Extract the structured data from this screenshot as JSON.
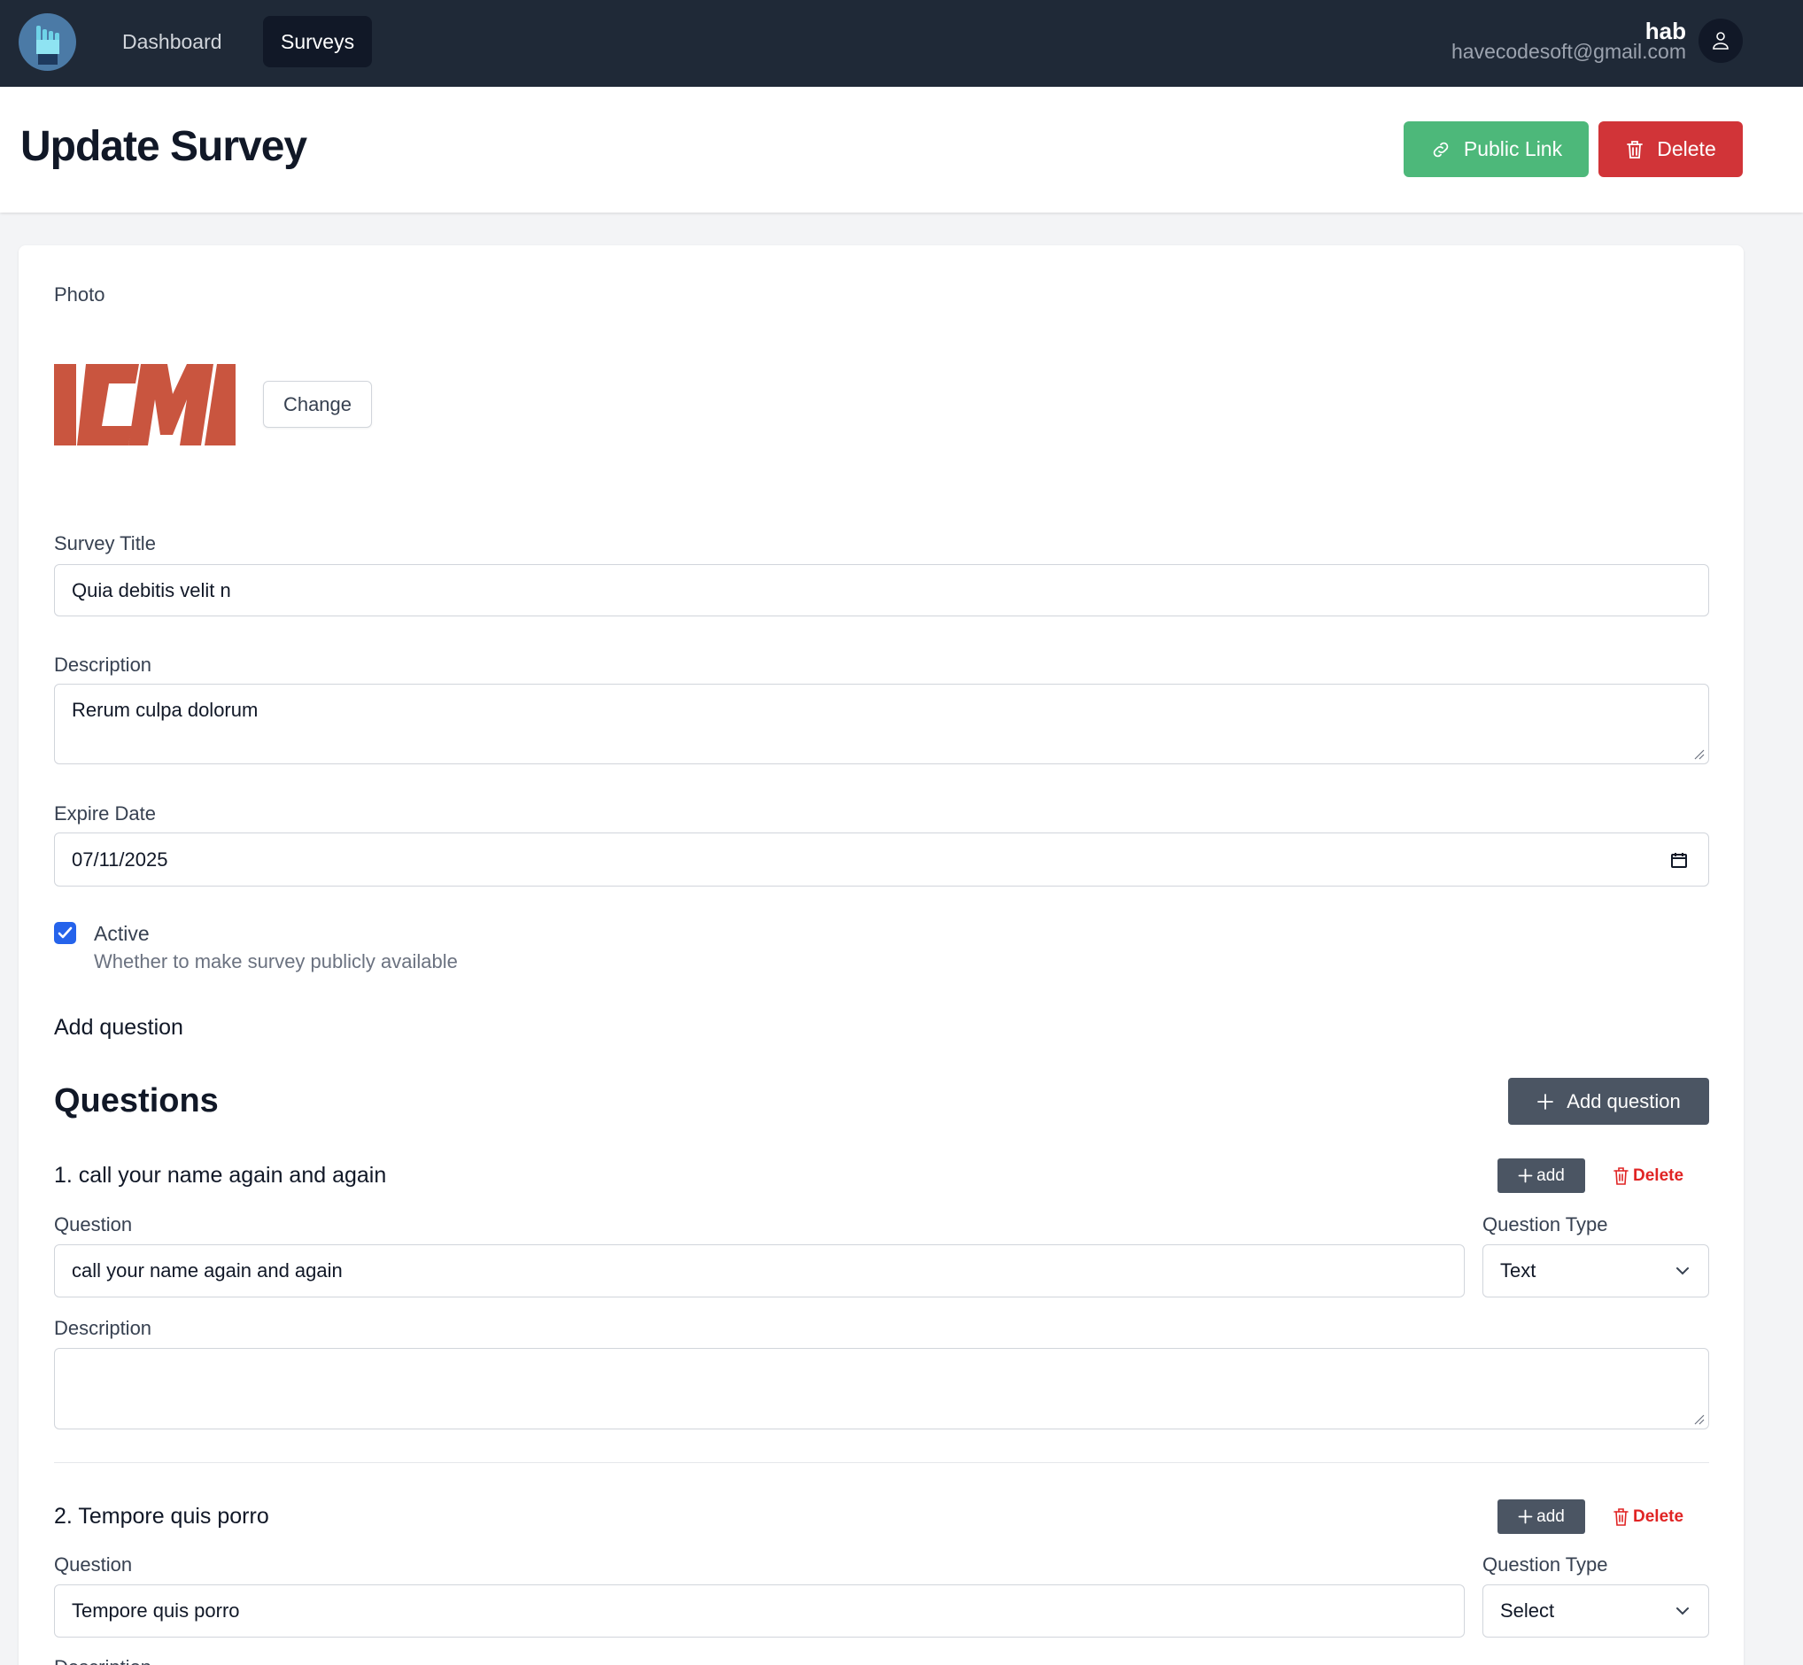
{
  "nav": {
    "links": [
      "Dashboard",
      "Surveys"
    ],
    "active_index": 1,
    "user_name": "hab",
    "user_email": "havecodesoft@gmail.com"
  },
  "header": {
    "title": "Update Survey",
    "public_link_label": "Public Link",
    "delete_label": "Delete"
  },
  "form": {
    "photo_label": "Photo",
    "photo_logo_text": "ICMI",
    "change_button": "Change",
    "survey_title_label": "Survey Title",
    "survey_title_value": "Quia debitis velit n",
    "description_label": "Description",
    "description_value": "Rerum culpa dolorum",
    "expire_date_label": "Expire Date",
    "expire_date_value": "07/11/2025",
    "active_checked": true,
    "active_label": "Active",
    "active_help": "Whether to make survey publicly available",
    "add_question_text": "Add question"
  },
  "questions": {
    "title": "Questions",
    "add_button": "Add question",
    "small_add_label": "add",
    "small_delete_label": "Delete",
    "question_label": "Question",
    "type_label": "Question Type",
    "description_label": "Description",
    "items": [
      {
        "heading": "1. call your name again and again",
        "question": "call your name again and again",
        "type": "Text",
        "description": ""
      },
      {
        "heading": "2. Tempore quis porro",
        "question": "Tempore quis porro",
        "type": "Select",
        "description": ""
      }
    ]
  },
  "colors": {
    "navbar": "#1f2937",
    "public_link": "#4db87a",
    "delete": "#d13438",
    "checkbox": "#2563eb",
    "logo_red": "#c9553f"
  }
}
